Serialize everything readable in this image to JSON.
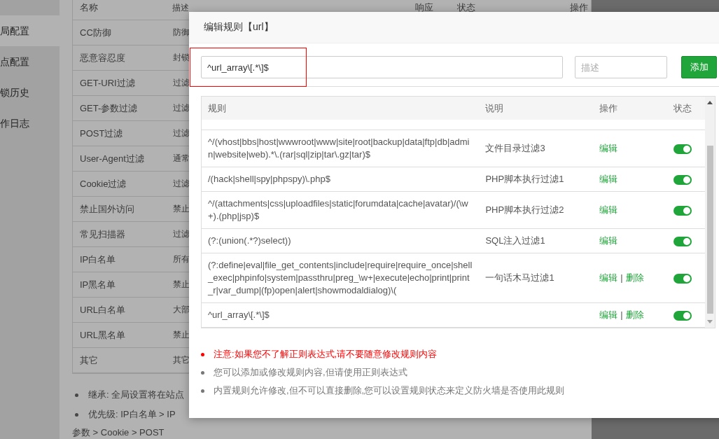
{
  "sidebar": {
    "items": [
      {
        "label": "局配置",
        "selected": true
      },
      {
        "label": "点配置",
        "selected": false
      },
      {
        "label": "锁历史",
        "selected": false
      },
      {
        "label": "作日志",
        "selected": false
      }
    ]
  },
  "background_table": {
    "columns": [
      "名称",
      "描述",
      "响应",
      "状态",
      "操作"
    ],
    "rows": [
      [
        "CC防御",
        "防御"
      ],
      [
        "恶意容忍度",
        "封锁"
      ],
      [
        "GET-URI过滤",
        "过滤"
      ],
      [
        "GET-参数过滤",
        "过滤"
      ],
      [
        "POST过滤",
        "过滤"
      ],
      [
        "User-Agent过滤",
        "通常"
      ],
      [
        "Cookie过滤",
        "过滤"
      ],
      [
        "禁止国外访问",
        "禁止"
      ],
      [
        "常见扫描器",
        "过滤"
      ],
      [
        "IP白名单",
        "所有"
      ],
      [
        "IP黑名单",
        "禁止"
      ],
      [
        "URL白名单",
        "大部"
      ],
      [
        "URL黑名单",
        "禁止"
      ],
      [
        "其它",
        "其它"
      ]
    ]
  },
  "background_notes": [
    "继承: 全局设置将在站点",
    "优先级: IP白名单 > IP"
  ],
  "background_note_continuation": "参数 > Cookie > POST",
  "dialog": {
    "title": "编辑规则【url】",
    "rule_input": {
      "value": "^url_array\\[.*\\]$"
    },
    "description_input": {
      "placeholder": "描述"
    },
    "add_button": "添加",
    "rules_table": {
      "columns": [
        "规则",
        "说明",
        "操作",
        "状态"
      ],
      "separator": "|",
      "rows": [
        {
          "rule": "^/(vhost|bbs|host|wwwroot|www|site|root|backup|data|ftp|db|admin|website|web).*\\.(rar|sql|zip|tar\\.gz|tar)$",
          "description": "文件目录过滤3",
          "actions": [
            "编辑"
          ],
          "on": true
        },
        {
          "rule": "/(hack|shell|spy|phpspy)\\.php$",
          "description": "PHP脚本执行过滤1",
          "actions": [
            "编辑"
          ],
          "on": true
        },
        {
          "rule": "^/(attachments|css|uploadfiles|static|forumdata|cache|avatar)/(\\w+).(php|jsp)$",
          "description": "PHP脚本执行过滤2",
          "actions": [
            "编辑"
          ],
          "on": true
        },
        {
          "rule": "(?:(union(.*?)select))",
          "description": "SQL注入过滤1",
          "actions": [
            "编辑"
          ],
          "on": true
        },
        {
          "rule": "(?:define|eval|file_get_contents|include|require|require_once|shell_exec|phpinfo|system|passthru|preg_\\w+|execute|echo|print|print_r|var_dump|(fp)open|alert|showmodaldialog)\\(",
          "description": "一句话木马过滤1",
          "actions": [
            "编辑",
            "删除"
          ],
          "on": true
        },
        {
          "rule": "^url_array\\[.*\\]$",
          "actions": [
            "编辑",
            "删除"
          ],
          "on": true
        }
      ]
    },
    "notes": [
      {
        "kind": "warning",
        "text": "注意:如果您不了解正则表达式,请不要随意修改规则内容"
      },
      {
        "kind": "info",
        "text": "您可以添加或修改规则内容,但请使用正则表达式"
      },
      {
        "kind": "info",
        "text": "内置规则允许修改,但不可以直接删除,您可以设置规则状态来定义防火墙是否使用此规则"
      }
    ]
  }
}
